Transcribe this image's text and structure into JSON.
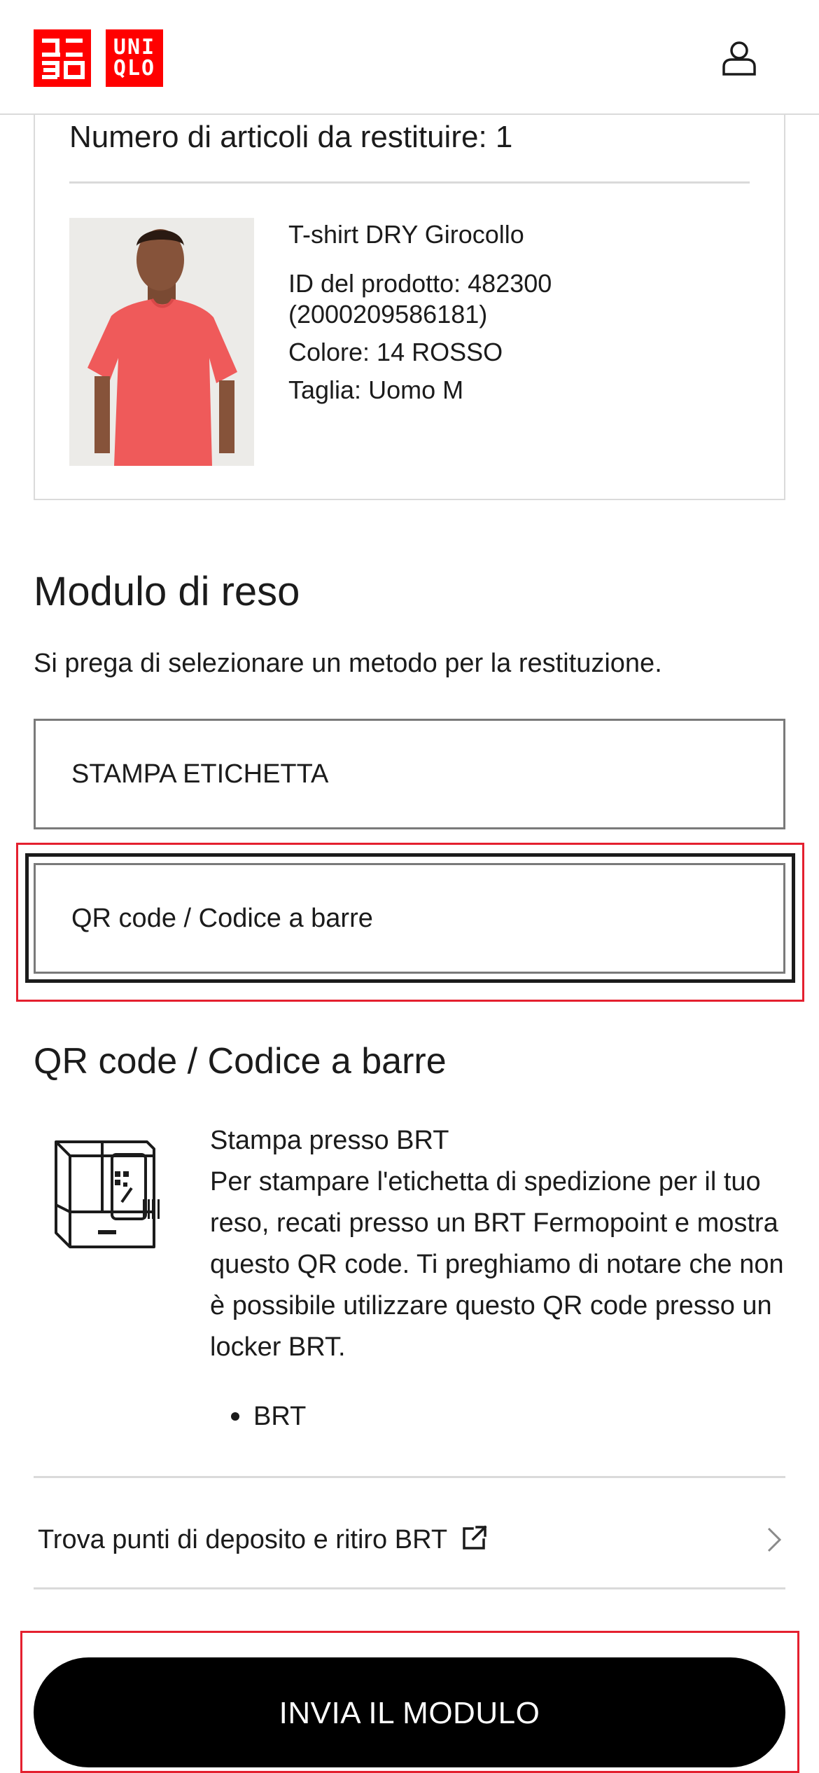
{
  "header": {
    "logo_top": "UNI",
    "logo_bottom": "QLO",
    "logo_kana_top": "ユニ",
    "logo_kana_bottom": "クロ"
  },
  "order": {
    "items_count_label": "Numero di articoli da restituire: 1",
    "product": {
      "name": "T-shirt DRY Girocollo",
      "id_line": "ID del prodotto: 482300",
      "code_line": "(2000209586181)",
      "color_line": "Colore: 14 ROSSO",
      "size_line": "Taglia: Uomo M",
      "shirt_color": "#ef5a5a"
    }
  },
  "return_form": {
    "title": "Modulo di reso",
    "subtitle": "Si prega di selezionare un metodo per la restituzione.",
    "options": [
      {
        "label": "STAMPA ETICHETTA",
        "selected": false
      },
      {
        "label": "QR code / Codice a barre",
        "selected": true
      }
    ]
  },
  "qr_section": {
    "title": "QR code / Codice a barre",
    "print_title": "Stampa presso BRT",
    "description": "Per stampare l'etichetta di spedizione per il tuo reso, recati presso un BRT Fermopoint e mostra questo QR code. Ti preghiamo di notare che non è possibile utilizzare questo QR code presso un locker BRT.",
    "carriers": [
      "BRT"
    ],
    "find_link_label": "Trova punti di deposito e ritiro BRT"
  },
  "submit": {
    "label": "INVIA IL MODULO"
  },
  "colors": {
    "brand_red": "#ff0000",
    "highlight_red": "#e4202f",
    "button_black": "#000000",
    "border_gray": "#7a7a7a",
    "divider_gray": "#dadada"
  }
}
